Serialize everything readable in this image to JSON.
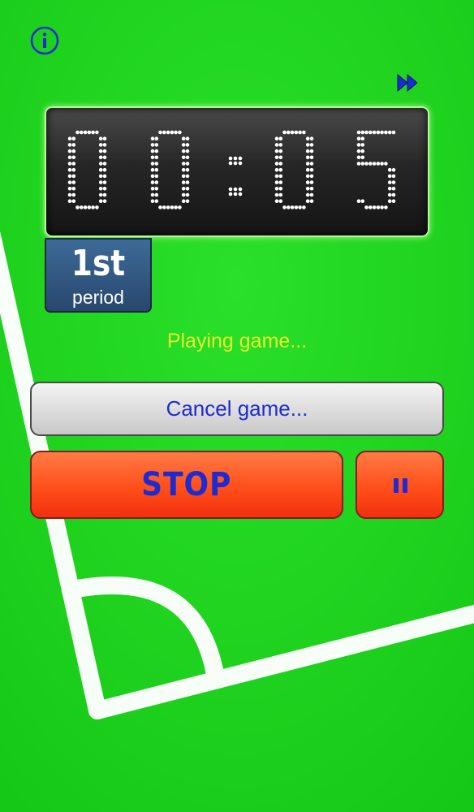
{
  "app": {
    "icons": {
      "info": "info-circle-icon",
      "fast_forward": "fast-forward-icon",
      "pause": "pause-icon"
    },
    "colors": {
      "field_green": "#1ed61e",
      "field_line": "#ffffff",
      "status_text": "#e6f22a",
      "button_text": "#1d2bd0",
      "stop_button": "#ff4f1a",
      "cancel_button": "#dcdcdc",
      "period_badge": "#28476d",
      "clock_background": "#1a1a1a",
      "clock_dots": "#ffffff"
    }
  },
  "clock": {
    "time": "00:05",
    "digits": [
      "0",
      "0",
      "0",
      "5"
    ]
  },
  "period": {
    "number": "1st",
    "label": "period"
  },
  "status": {
    "text": "Playing game..."
  },
  "buttons": {
    "cancel_label": "Cancel game...",
    "stop_label": "STOP"
  }
}
